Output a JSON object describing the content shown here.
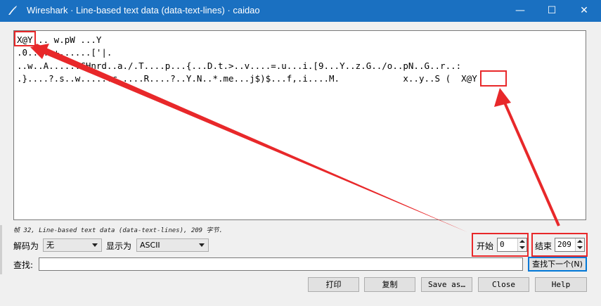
{
  "window": {
    "title": "Wireshark · Line-based text data (data-text-lines) · caidao",
    "controls": {
      "minimize": "—",
      "maximize": "☐",
      "close": "✕"
    }
  },
  "text_lines": [
    "X@Y... w.pW ...Y",
    ".0.....+......['|.",
    "..w..A......CHnrd..a./.T....p...{...D.t.>..v....=.u...i.[9...Y..z.G../o..pN..G..r..:",
    ".}....?.s..w......c.....R....?..Y.N..*.me...j$)$...f,.i....M.            x..y..S (  X@Y"
  ],
  "status_text": "帧 32, Line-based text data (data-text-lines), 209 字节.",
  "decode": {
    "label": "解码为",
    "value": "无"
  },
  "show": {
    "label": "显示为",
    "value": "ASCII"
  },
  "start": {
    "label": "开始",
    "value": "0"
  },
  "end": {
    "label": "结束",
    "value": "209"
  },
  "find": {
    "label": "查找:",
    "value": "",
    "next_button": "查找下一个(N)"
  },
  "buttons": {
    "print": "打印",
    "copy": "复制",
    "save_as": "Save as…",
    "close": "Close",
    "help": "Help"
  },
  "annotation": {
    "color": "#e8282a"
  }
}
